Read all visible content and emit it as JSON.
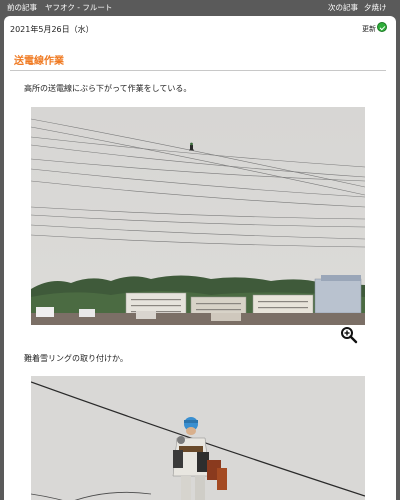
{
  "topbar": {
    "prev_label": "前の記事",
    "prev_title": "ヤフオク - フルート",
    "next_label": "次の記事",
    "next_title": "夕焼け"
  },
  "post": {
    "date": "2021年5月26日（水）",
    "update_label": "更新",
    "title": "送電線作業",
    "paragraph1": "高所の送電線にぶら下がって作業をしている。",
    "paragraph2": "難着雪リングの取り付けか。"
  },
  "icons": {
    "update": "refresh-icon",
    "zoom": "magnify-plus-icon"
  },
  "colors": {
    "title": "#f07a22",
    "topbar": "#5a5a5a",
    "update_icon": "#2fae3a"
  }
}
